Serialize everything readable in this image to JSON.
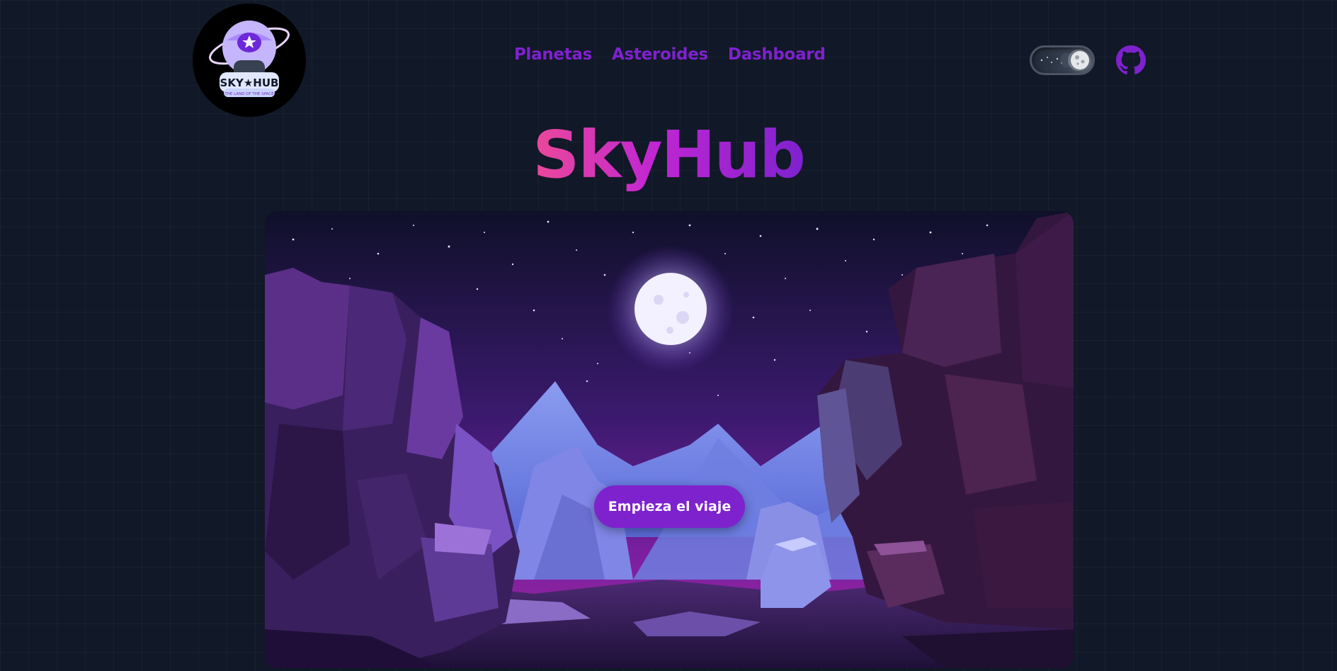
{
  "logo": {
    "title": "SKY HUB",
    "tagline": "THE LAND OF THE SPACE"
  },
  "nav": {
    "items": [
      {
        "label": "Planetas"
      },
      {
        "label": "Asteroides"
      },
      {
        "label": "Dashboard"
      }
    ]
  },
  "header": {
    "theme_toggle_icon": "moon-icon",
    "github_icon": "github-icon"
  },
  "hero": {
    "title": "SkyHub",
    "cta_label": "Empieza el viaje",
    "illustration": "canyon-night-moon"
  },
  "colors": {
    "background": "#111827",
    "accent": "#7e22ce",
    "title_gradient_start": "#ec4899",
    "title_gradient_end": "#7e22ce"
  }
}
